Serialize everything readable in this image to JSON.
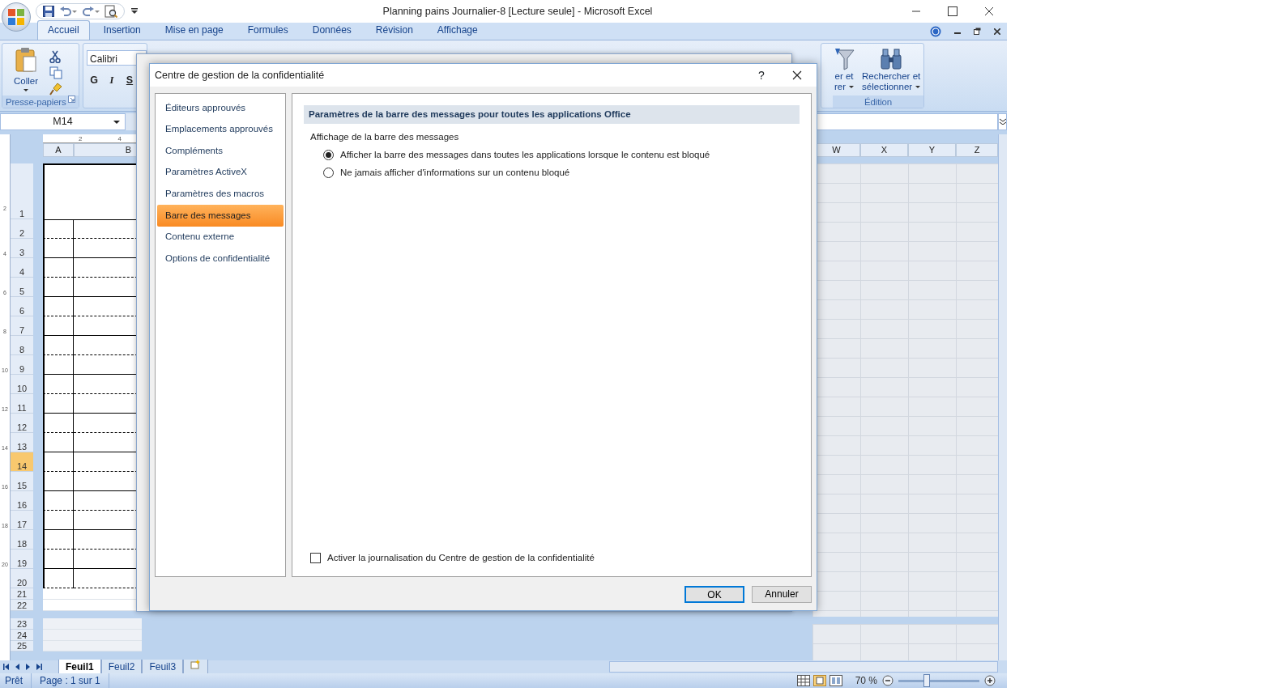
{
  "window": {
    "title": "Planning pains Journalier-8  [Lecture seule] - Microsoft Excel"
  },
  "ribbon_tabs": [
    {
      "label": "Accueil",
      "selected": true
    },
    {
      "label": "Insertion",
      "selected": false
    },
    {
      "label": "Mise en page",
      "selected": false
    },
    {
      "label": "Formules",
      "selected": false
    },
    {
      "label": "Données",
      "selected": false
    },
    {
      "label": "Révision",
      "selected": false
    },
    {
      "label": "Affichage",
      "selected": false
    }
  ],
  "ribbon": {
    "paste_label": "Coller",
    "clipboard_group": "Presse-papiers",
    "font_name": "Calibri",
    "font_buttons": [
      "G",
      "I",
      "S"
    ],
    "sort_filter_label": [
      "er et",
      "rer"
    ],
    "find_label": [
      "Rechercher et",
      "sélectionner"
    ],
    "editing_group": "Édition"
  },
  "name_box": "M14",
  "h_ruler_labels": [
    "2",
    "4"
  ],
  "columns_left": [
    "A",
    "B"
  ],
  "columns_right": [
    "W",
    "X",
    "Y",
    "Z"
  ],
  "v_ruler_labels": [
    "2",
    "4",
    "6",
    "8",
    "10",
    "12",
    "14",
    "16",
    "18",
    "20"
  ],
  "rows": [
    {
      "label": "1",
      "selected": false
    },
    {
      "label": "2",
      "selected": false
    },
    {
      "label": "3",
      "selected": false
    },
    {
      "label": "4",
      "selected": false
    },
    {
      "label": "5",
      "selected": false
    },
    {
      "label": "6",
      "selected": false
    },
    {
      "label": "7",
      "selected": false
    },
    {
      "label": "8",
      "selected": false
    },
    {
      "label": "9",
      "selected": false
    },
    {
      "label": "10",
      "selected": false
    },
    {
      "label": "11",
      "selected": false
    },
    {
      "label": "12",
      "selected": false
    },
    {
      "label": "13",
      "selected": false
    },
    {
      "label": "14",
      "selected": true
    },
    {
      "label": "15",
      "selected": false
    },
    {
      "label": "16",
      "selected": false
    },
    {
      "label": "17",
      "selected": false
    },
    {
      "label": "18",
      "selected": false
    },
    {
      "label": "19",
      "selected": false
    },
    {
      "label": "20",
      "selected": false
    },
    {
      "label": "21",
      "selected": false
    },
    {
      "label": "22",
      "selected": false
    },
    {
      "label": "23",
      "selected": false
    },
    {
      "label": "24",
      "selected": false
    },
    {
      "label": "25",
      "selected": false
    }
  ],
  "sheet_tabs": [
    {
      "label": "Feuil1",
      "selected": true
    },
    {
      "label": "Feuil2",
      "selected": false
    },
    {
      "label": "Feuil3",
      "selected": false
    }
  ],
  "status_bar": {
    "ready": "Prêt",
    "page": "Page : 1 sur 1",
    "zoom": "70 %",
    "zoom_slider": {
      "level": 0.35
    }
  },
  "dialog": {
    "title": "Centre de gestion de la confidentialité",
    "help": "?",
    "nav": [
      {
        "label": "Éditeurs approuvés",
        "selected": false
      },
      {
        "label": "Emplacements approuvés",
        "selected": false
      },
      {
        "label": "Compléments",
        "selected": false
      },
      {
        "label": "Paramètres ActiveX",
        "selected": false
      },
      {
        "label": "Paramètres des macros",
        "selected": false
      },
      {
        "label": "Barre des messages",
        "selected": true
      },
      {
        "label": "Contenu externe",
        "selected": false
      },
      {
        "label": "Options de confidentialité",
        "selected": false
      }
    ],
    "section_title": "Paramètres de la barre des messages pour toutes les applications Office",
    "group_label": "Affichage de la barre des messages",
    "options": [
      {
        "label": "Afficher la barre des messages dans toutes les applications lorsque le contenu est bloqué",
        "selected": true
      },
      {
        "label": "Ne jamais afficher d'informations sur un contenu bloqué",
        "selected": false
      }
    ],
    "logging": {
      "label": "Activer la journalisation du Centre de gestion de la confidentialité",
      "checked": false
    },
    "buttons": [
      "OK",
      "Annuler"
    ]
  }
}
